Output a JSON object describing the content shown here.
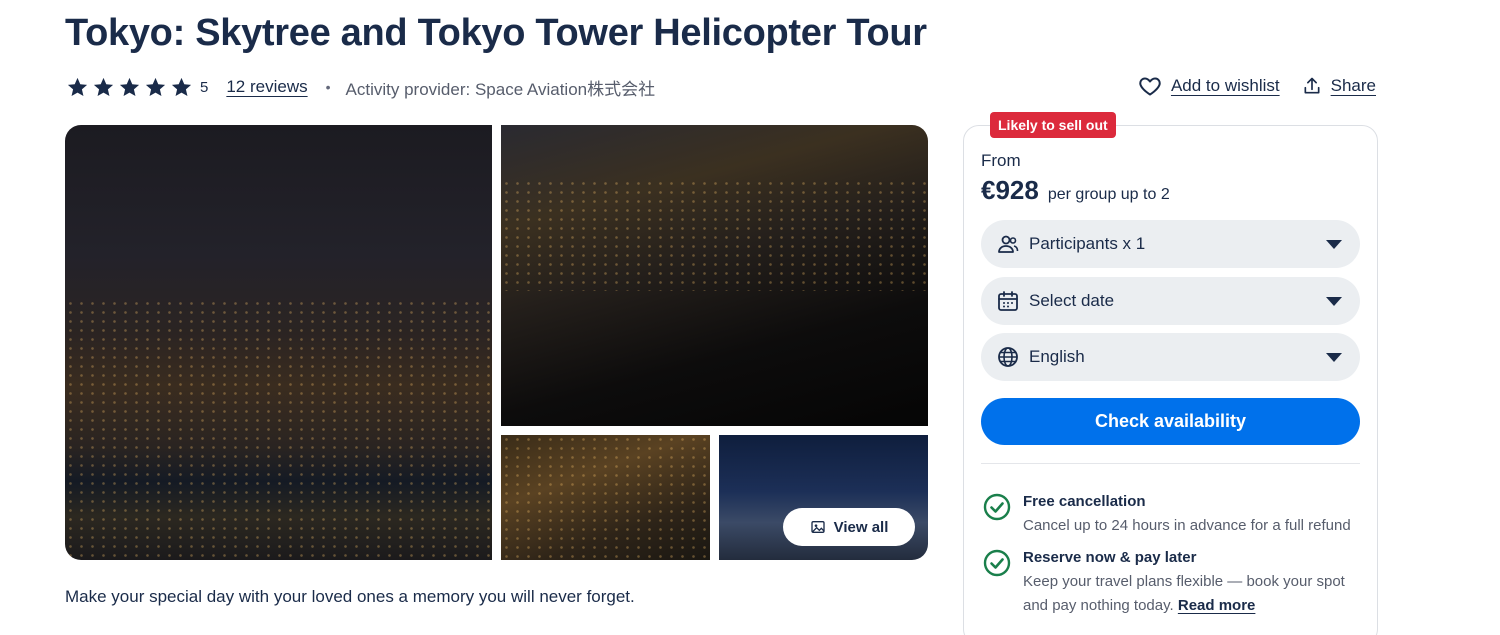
{
  "title": "Tokyo: Skytree and Tokyo Tower Helicopter Tour",
  "rating": {
    "value": "5",
    "stars": 5,
    "reviews_label": "12 reviews"
  },
  "separator": "•",
  "provider": "Activity provider: Space Aviation株式会社",
  "actions": {
    "wishlist_label": "Add to wishlist",
    "share_label": "Share"
  },
  "gallery": {
    "view_all_label": "View all"
  },
  "description": "Make your special day with your loved ones a memory you will never forget.",
  "booking": {
    "badge": "Likely to sell out",
    "from_label": "From",
    "price": "€928",
    "price_unit": "per group up to 2",
    "participants_label": "Participants x 1",
    "date_label": "Select date",
    "language_label": "English",
    "cta_label": "Check availability",
    "features": [
      {
        "title": "Free cancellation",
        "description": "Cancel up to 24 hours in advance for a full refund"
      },
      {
        "title": "Reserve now & pay later",
        "description": "Keep your travel plans flexible — book your spot and pay nothing today.",
        "link": "Read more"
      }
    ]
  },
  "colors": {
    "brand_blue": "#0071eb",
    "text_navy": "#1a2b49",
    "badge_red": "#dc2a3c",
    "check_green": "#1a7f4b",
    "select_bg": "#ebeef1"
  }
}
